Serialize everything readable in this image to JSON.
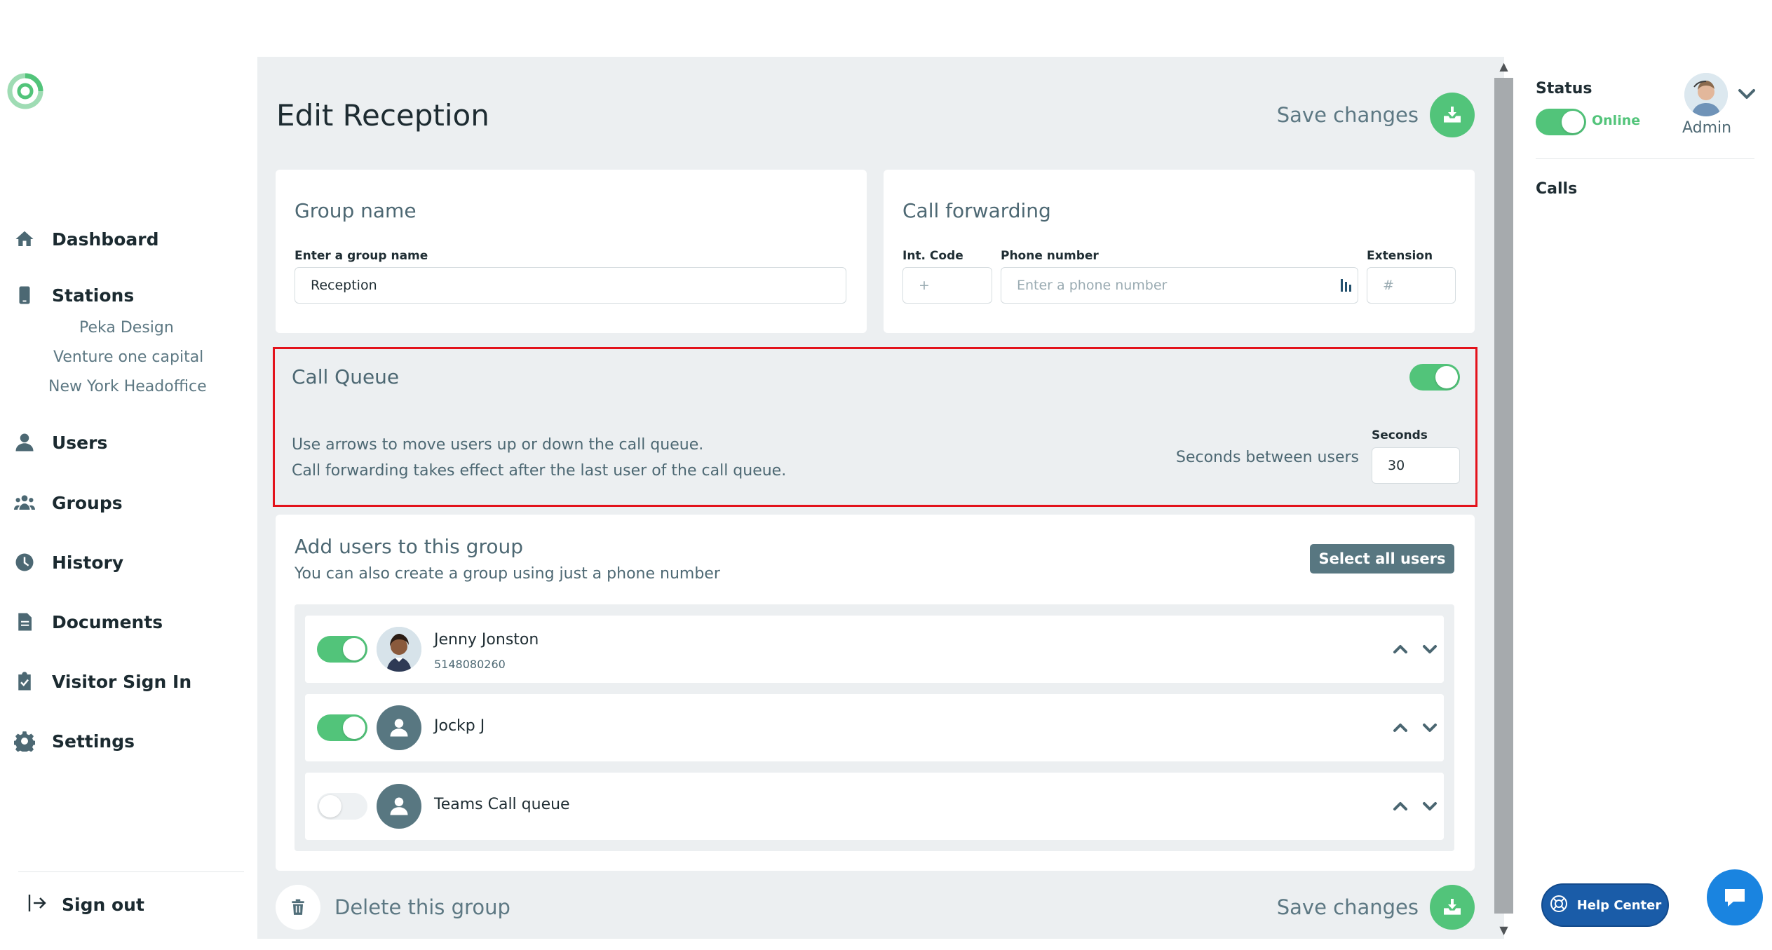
{
  "sidebar": {
    "nav": [
      {
        "label": "Dashboard",
        "icon": "home-icon"
      },
      {
        "label": "Stations",
        "icon": "station-icon"
      },
      {
        "label": "Users",
        "icon": "user-icon"
      },
      {
        "label": "Groups",
        "icon": "groups-icon"
      },
      {
        "label": "History",
        "icon": "clock-icon"
      },
      {
        "label": "Documents",
        "icon": "document-icon"
      },
      {
        "label": "Visitor Sign In",
        "icon": "clipboard-check-icon"
      },
      {
        "label": "Settings",
        "icon": "gear-icon"
      }
    ],
    "stations": [
      "Peka Design",
      "Venture one capital",
      "New York Headoffice"
    ],
    "signout_label": "Sign out"
  },
  "page": {
    "title": "Edit Reception",
    "save_label": "Save changes",
    "delete_label": "Delete this group"
  },
  "group_name": {
    "title": "Group name",
    "label": "Enter a group name",
    "value": "Reception"
  },
  "call_forwarding": {
    "title": "Call forwarding",
    "int_code_label": "Int. Code",
    "int_code_placeholder": "+",
    "phone_label": "Phone number",
    "phone_placeholder": "Enter a phone number",
    "extension_label": "Extension",
    "extension_placeholder": "#"
  },
  "call_queue": {
    "title": "Call Queue",
    "enabled": true,
    "desc_line1": "Use arrows to move users up or down the call queue.",
    "desc_line2": "Call forwarding takes effect after the last user of the call queue.",
    "seconds_caption": "Seconds between users",
    "seconds_label": "Seconds",
    "seconds_value": "30"
  },
  "add_users": {
    "title": "Add users to this group",
    "subtitle": "You can also create a group using just a phone number",
    "select_all_label": "Select all users",
    "users": [
      {
        "name": "Jenny Jonston",
        "phone": "5148080260",
        "enabled": true,
        "has_photo": true
      },
      {
        "name": "Jockp J",
        "phone": "",
        "enabled": true,
        "has_photo": false
      },
      {
        "name": "Teams Call queue",
        "phone": "",
        "enabled": false,
        "has_photo": false
      }
    ]
  },
  "right_panel": {
    "status_label": "Status",
    "status_value": "Online",
    "admin_label": "Admin",
    "calls_label": "Calls",
    "help_center_label": "Help Center"
  },
  "colors": {
    "accent_green": "#52c47a",
    "slate": "#587781",
    "highlight_red": "#e3121b",
    "help_blue": "#1a5ca8",
    "chat_blue": "#1a84e0"
  }
}
